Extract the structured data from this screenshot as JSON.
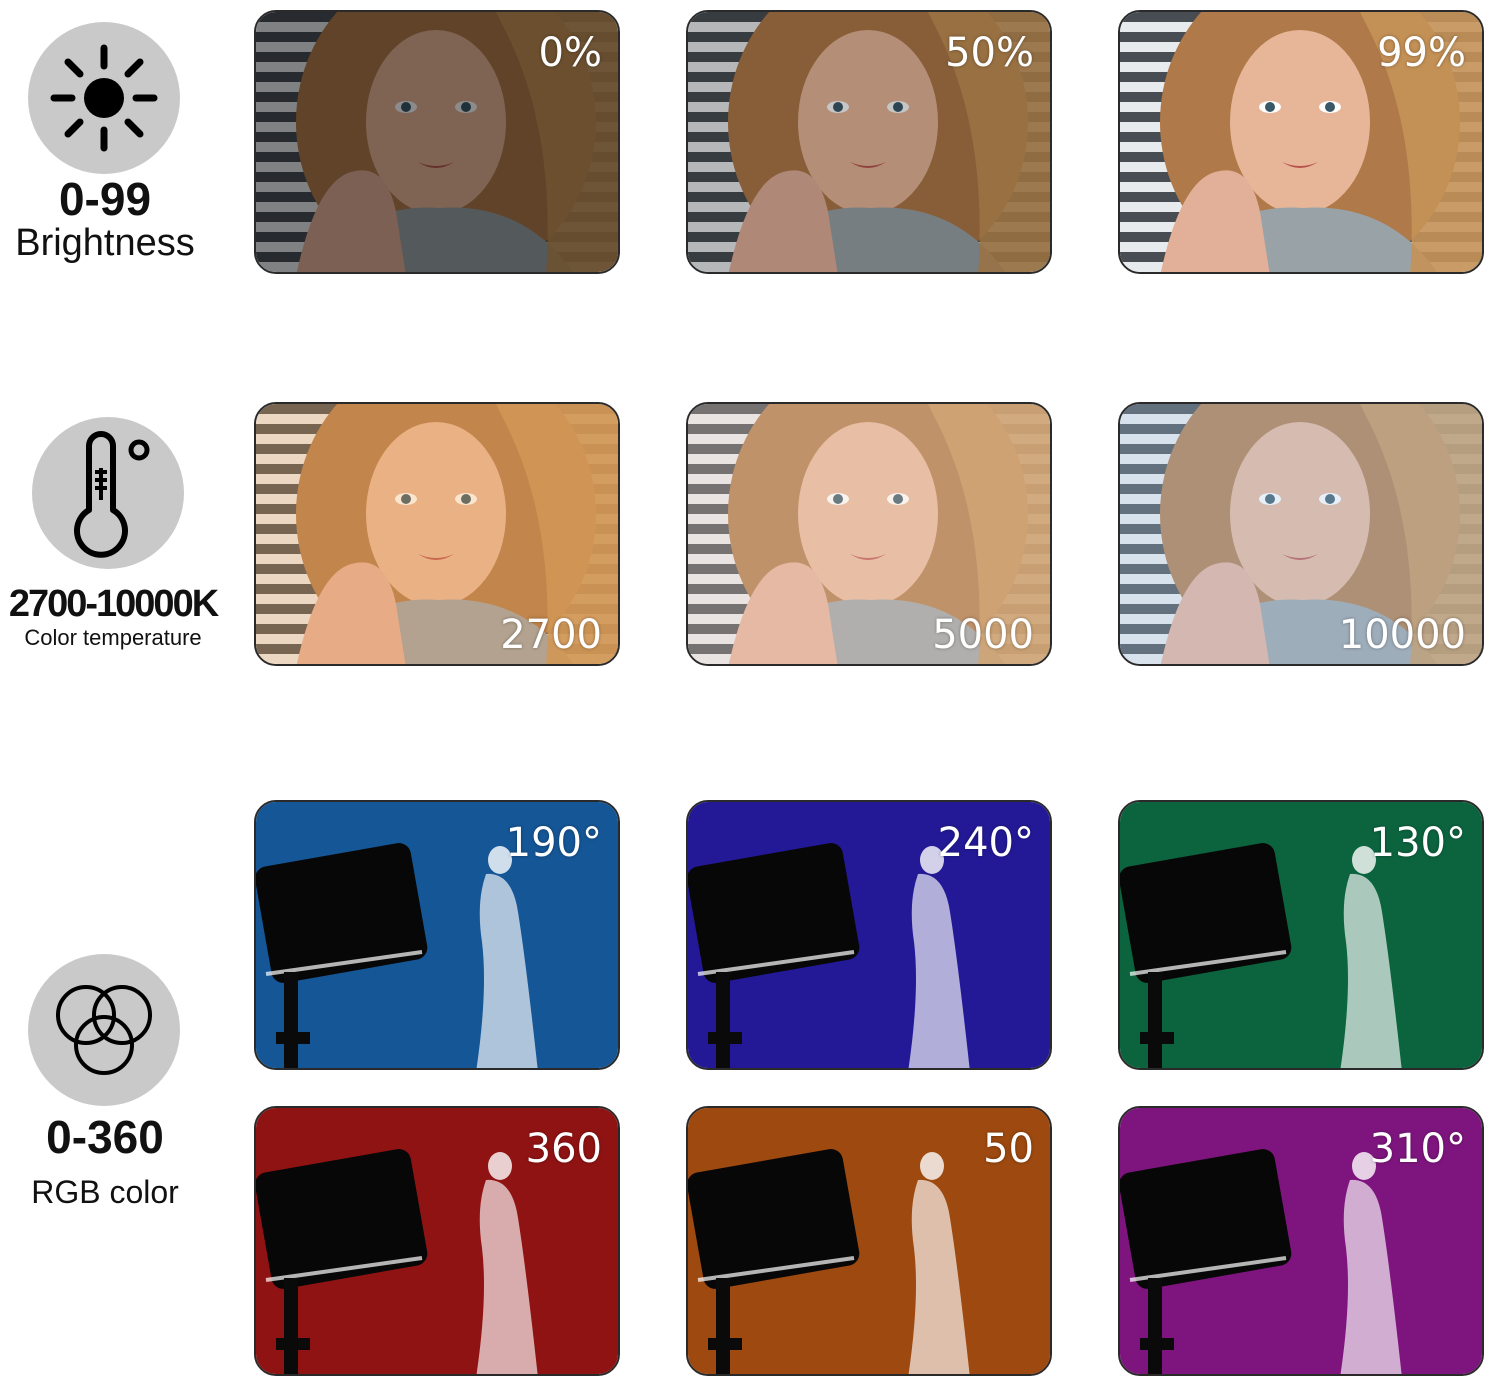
{
  "features": {
    "brightness": {
      "value": "0-99",
      "label": "Brightness",
      "icon": "sun-icon"
    },
    "temperature": {
      "value": "2700-10000K",
      "label": "Color temperature",
      "icon": "thermometer-icon"
    },
    "rgb": {
      "value": "0-360",
      "label": "RGB color",
      "icon": "rgb-circles-icon"
    }
  },
  "brightness_tiles": [
    {
      "label": "0%",
      "level": 0.0
    },
    {
      "label": "50%",
      "level": 0.5
    },
    {
      "label": "99%",
      "level": 0.99
    }
  ],
  "temperature_tiles": [
    {
      "label": "2700",
      "tint": "#f0a050"
    },
    {
      "label": "5000",
      "tint": "#e8d2c0"
    },
    {
      "label": "10000",
      "tint": "#a8c8e8"
    }
  ],
  "rgb_tiles": [
    {
      "label": "190°",
      "color": "#1a6ab8"
    },
    {
      "label": "240°",
      "color": "#2b1fb8"
    },
    {
      "label": "130°",
      "color": "#0f7a4e"
    },
    {
      "label": "360",
      "color": "#b01818"
    },
    {
      "label": "50",
      "color": "#c05a14"
    },
    {
      "label": "310°",
      "color": "#9a1a9a"
    }
  ]
}
